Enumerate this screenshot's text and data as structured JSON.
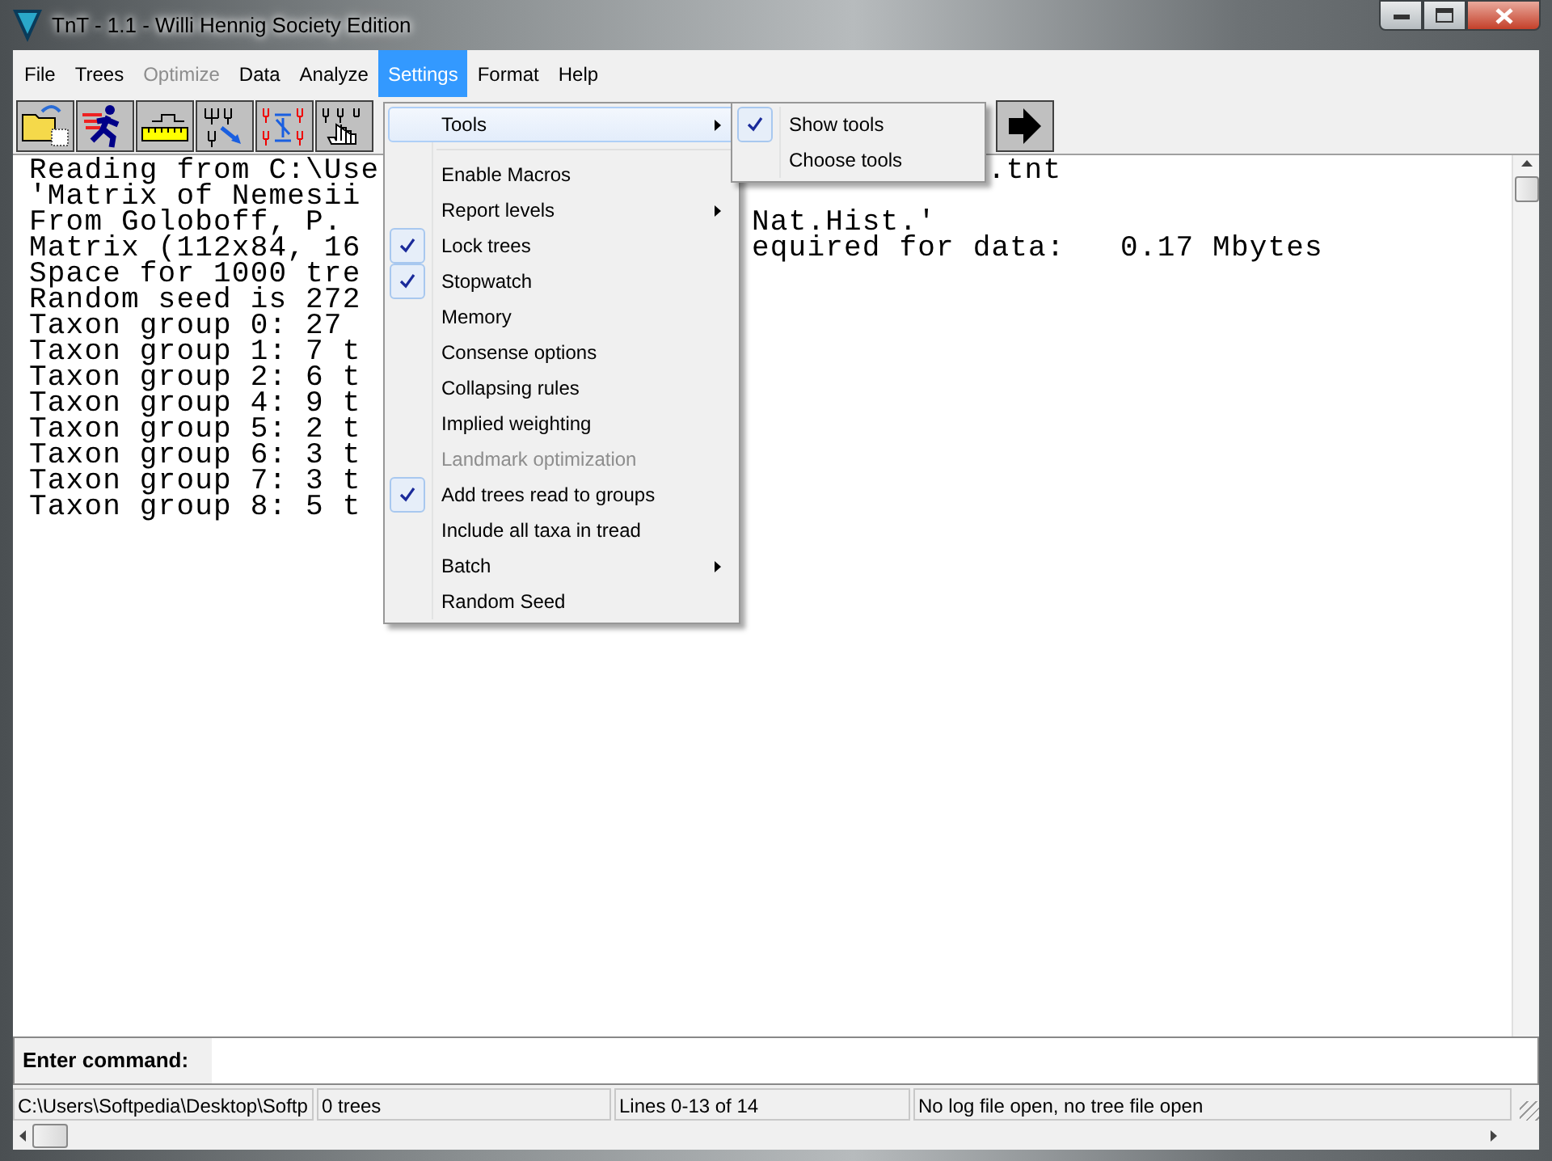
{
  "window": {
    "title": "TnT - 1.1 - Willi Hennig Society Edition"
  },
  "menu_bar": [
    {
      "label": "File",
      "disabled": false,
      "selected": false
    },
    {
      "label": "Trees",
      "disabled": false,
      "selected": false
    },
    {
      "label": "Optimize",
      "disabled": true,
      "selected": false
    },
    {
      "label": "Data",
      "disabled": false,
      "selected": false
    },
    {
      "label": "Analyze",
      "disabled": false,
      "selected": false
    },
    {
      "label": "Settings",
      "disabled": false,
      "selected": true
    },
    {
      "label": "Format",
      "disabled": false,
      "selected": false
    },
    {
      "label": "Help",
      "disabled": false,
      "selected": false
    }
  ],
  "settings_menu": {
    "items": [
      {
        "kind": "submenu",
        "label": "Tools",
        "checked": false,
        "disabled": false,
        "highlighted": true
      },
      {
        "kind": "separator"
      },
      {
        "kind": "item",
        "label": "Enable Macros",
        "checked": false,
        "disabled": false,
        "highlighted": false
      },
      {
        "kind": "submenu",
        "label": "Report levels",
        "checked": false,
        "disabled": false,
        "highlighted": false
      },
      {
        "kind": "item",
        "label": "Lock trees",
        "checked": true,
        "disabled": false,
        "highlighted": false
      },
      {
        "kind": "item",
        "label": "Stopwatch",
        "checked": true,
        "disabled": false,
        "highlighted": false
      },
      {
        "kind": "item",
        "label": "Memory",
        "checked": false,
        "disabled": false,
        "highlighted": false
      },
      {
        "kind": "item",
        "label": "Consense options",
        "checked": false,
        "disabled": false,
        "highlighted": false
      },
      {
        "kind": "item",
        "label": "Collapsing rules",
        "checked": false,
        "disabled": false,
        "highlighted": false
      },
      {
        "kind": "item",
        "label": "Implied weighting",
        "checked": false,
        "disabled": false,
        "highlighted": false
      },
      {
        "kind": "item",
        "label": "Landmark optimization",
        "checked": false,
        "disabled": true,
        "highlighted": false
      },
      {
        "kind": "item",
        "label": "Add trees read to groups",
        "checked": true,
        "disabled": false,
        "highlighted": false
      },
      {
        "kind": "item",
        "label": "Include all taxa in tread",
        "checked": false,
        "disabled": false,
        "highlighted": false
      },
      {
        "kind": "submenu",
        "label": "Batch",
        "checked": false,
        "disabled": false,
        "highlighted": false
      },
      {
        "kind": "item",
        "label": "Random Seed",
        "checked": false,
        "disabled": false,
        "highlighted": false
      }
    ]
  },
  "tools_submenu": {
    "items": [
      {
        "label": "Show tools",
        "checked": true
      },
      {
        "label": "Choose tools",
        "checked": false
      }
    ]
  },
  "output": {
    "lines": [
      {
        "left": "Reading from C:\\Use",
        "right": ".tnt"
      },
      {
        "left": "'Matrix of Nemesii"
      },
      {
        "left": "From Goloboff, P.",
        "right": "Nat.Hist.'"
      },
      {
        "left": "Matrix (112x84, 16",
        "right": "equired for data:   0.17 Mbytes"
      },
      {
        "left": "Space for 1000 tre"
      },
      {
        "left": "Random seed is 272"
      },
      {
        "left": "Taxon group 0: 27"
      },
      {
        "left": "Taxon group 1: 7 t"
      },
      {
        "left": "Taxon group 2: 6 t"
      },
      {
        "left": "Taxon group 4: 9 t"
      },
      {
        "left": "Taxon group 5: 2 t"
      },
      {
        "left": "Taxon group 6: 3 t"
      },
      {
        "left": "Taxon group 7: 3 t"
      },
      {
        "left": "Taxon group 8: 5 t"
      }
    ]
  },
  "command": {
    "label": "Enter command:"
  },
  "status_bar": [
    "C:\\Users\\Softpedia\\Desktop\\Softp",
    "0 trees",
    "Lines 0-13 of 14",
    "No log file open, no tree file open"
  ]
}
